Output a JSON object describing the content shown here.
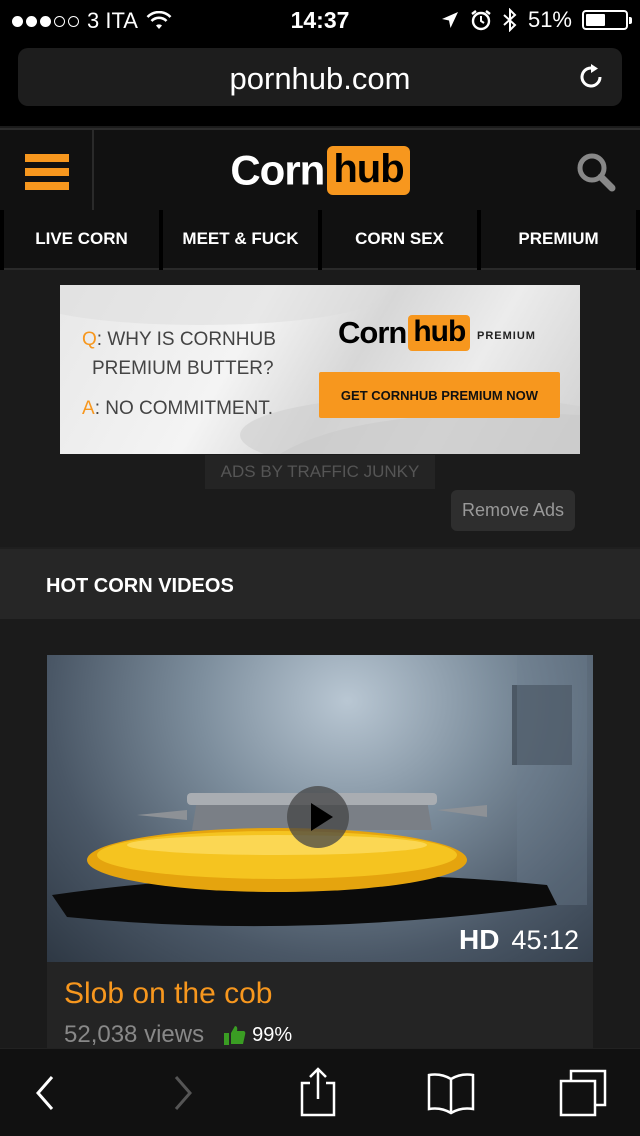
{
  "status_bar": {
    "carrier": "3 ITA",
    "signal_bars_filled": 3,
    "signal_bars_total": 5,
    "time": "14:37",
    "battery_percent": "51%",
    "battery_level": 0.51,
    "icons": [
      "wifi-icon",
      "location-arrow-icon",
      "alarm-icon",
      "bluetooth-icon",
      "battery-icon"
    ]
  },
  "browser": {
    "url": "pornhub.com"
  },
  "site_header": {
    "logo_left": "Corn",
    "logo_right": "hub",
    "accent_color": "#f7971e"
  },
  "nav": {
    "items": [
      {
        "label": "LIVE CORN"
      },
      {
        "label": "MEET & FUCK"
      },
      {
        "label": "CORN SEX"
      },
      {
        "label": "PREMIUM"
      }
    ]
  },
  "ad": {
    "q_prefix": "Q",
    "q_text": ": WHY IS CORNHUB",
    "q_text2": "PREMIUM BUTTER?",
    "a_prefix": "A",
    "a_text": ": NO COMMITMENT.",
    "logo_left": "Corn",
    "logo_right": "hub",
    "logo_suffix": "PREMIUM",
    "cta": "GET CORNHUB PREMIUM NOW",
    "ads_by": "ADS BY TRAFFIC JUNKY",
    "remove_ads": "Remove Ads"
  },
  "section": {
    "title": "HOT CORN VIDEOS"
  },
  "video": {
    "quality": "HD",
    "duration": "45:12",
    "title": "Slob on the cob",
    "views": "52,038 views",
    "rating": "99%"
  }
}
